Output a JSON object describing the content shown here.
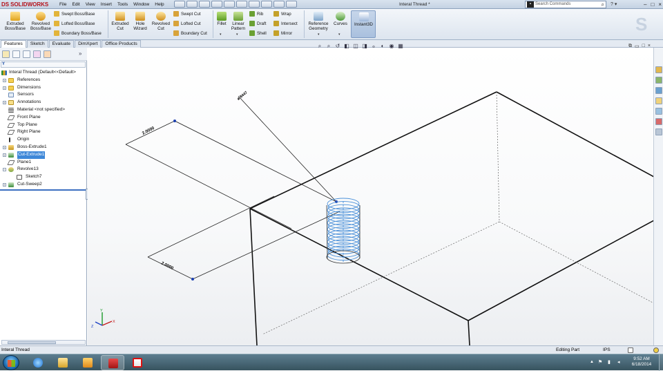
{
  "app": {
    "logo_text": "SOLIDWORKS",
    "menu": [
      "File",
      "Edit",
      "View",
      "Insert",
      "Tools",
      "Window",
      "Help"
    ],
    "document_title": "Interal Thread *",
    "search_placeholder": "Search Commands",
    "help_glyph": "?"
  },
  "ribbon": {
    "extruded_boss": "Extruded Boss/Base",
    "revolved_boss": "Revolved Boss/Base",
    "swept_boss": "Swept Boss/Base",
    "lofted_boss": "Lofted Boss/Base",
    "boundary_boss": "Boundary Boss/Base",
    "extruded_cut": "Extruded Cut",
    "hole_wizard": "Hole Wizard",
    "revolved_cut": "Revolved Cut",
    "swept_cut": "Swept Cut",
    "lofted_cut": "Lofted Cut",
    "boundary_cut": "Boundary Cut",
    "fillet": "Fillet",
    "linear_pattern": "Linear Pattern",
    "rib": "Rib",
    "draft": "Draft",
    "shell": "Shell",
    "wrap": "Wrap",
    "intersect": "Intersect",
    "mirror": "Mirror",
    "reference_geometry": "Reference Geometry",
    "curves": "Curves",
    "instant3d": "Instant3D"
  },
  "tabs": [
    "Features",
    "Sketch",
    "Evaluate",
    "DimXpert",
    "Office Products"
  ],
  "tree": {
    "root": "Interal Thread  (Default<<Default>",
    "items": [
      {
        "label": "References",
        "icon": "folder-icon",
        "expand": true
      },
      {
        "label": "Dimensions",
        "icon": "folder-icon",
        "expand": true
      },
      {
        "label": "Sensors",
        "icon": "sensors-icon",
        "expand": false
      },
      {
        "label": "Annotations",
        "icon": "annotations-icon",
        "expand": true
      },
      {
        "label": "Material <not specified>",
        "icon": "material-icon",
        "expand": false
      },
      {
        "label": "Front Plane",
        "icon": "plane-icon",
        "expand": false
      },
      {
        "label": "Top Plane",
        "icon": "plane-icon",
        "expand": false
      },
      {
        "label": "Right Plane",
        "icon": "plane-icon",
        "expand": false
      },
      {
        "label": "Origin",
        "icon": "origin-icon",
        "expand": false
      },
      {
        "label": "Boss-Extrude1",
        "icon": "extrude-icon",
        "expand": true
      },
      {
        "label": "Cut-Extrude1",
        "icon": "cut-icon",
        "expand": true,
        "selected": true
      },
      {
        "label": "Plane1",
        "icon": "plane-icon",
        "expand": false
      },
      {
        "label": "Revolve13",
        "icon": "revolve-icon",
        "expand": true
      },
      {
        "label": "Sketch7",
        "icon": "sketch-icon",
        "expand": false,
        "indent": true
      },
      {
        "label": "Cut-Sweep2",
        "icon": "sweep-icon",
        "expand": true
      }
    ]
  },
  "viewport": {
    "dim_left_top": "2.0000",
    "dim_left_bottom": "2.0000",
    "dim_diameter": "⌀.8447",
    "triad": {
      "x": "X",
      "y": "Y",
      "z": "Z"
    }
  },
  "status": {
    "left": "Interal Thread",
    "mode": "Editing Part",
    "units": "IPS"
  },
  "clock": {
    "time": "9:52 AM",
    "date": "6/18/2014"
  },
  "colors": {
    "accent": "#3f88d8",
    "thread": "#4a90d9",
    "brand": "#b5121b"
  }
}
